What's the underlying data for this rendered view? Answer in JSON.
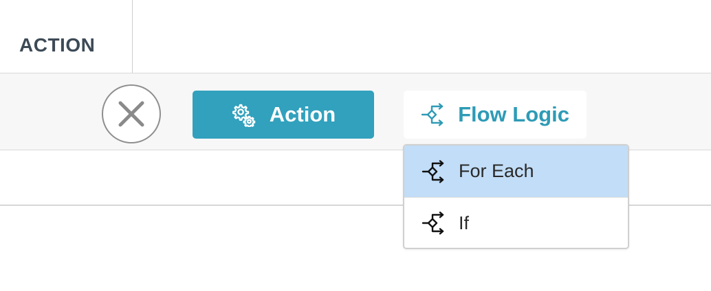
{
  "table": {
    "header_label": "ACTION"
  },
  "toolbar": {
    "close_label": "Close",
    "action_label": "Action",
    "flow_logic_label": "Flow Logic"
  },
  "dropdown": {
    "items": [
      {
        "label": "For Each",
        "icon": "flow-branch-icon",
        "highlighted": true
      },
      {
        "label": "If",
        "icon": "flow-branch-icon",
        "highlighted": false
      }
    ]
  },
  "colors": {
    "primary": "#31a1bd",
    "flow_text": "#2e9bb6",
    "highlight": "#c2ddf7",
    "header_text": "#3d4a56"
  }
}
